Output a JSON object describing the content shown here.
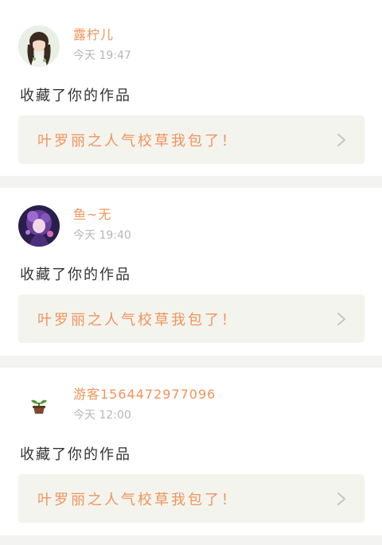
{
  "feed": {
    "items": [
      {
        "username": "露柠儿",
        "time": "今天 19:47",
        "action": "收藏了你的作品",
        "work_title": "叶罗丽之人气校草我包了！",
        "avatar_icon": "girl-avatar-icon"
      },
      {
        "username": "鱼~无",
        "time": "今天 19:40",
        "action": "收藏了你的作品",
        "work_title": "叶罗丽之人气校草我包了！",
        "avatar_icon": "purple-avatar-icon"
      },
      {
        "username": "游客1564472977096",
        "time": "今天 12:00",
        "action": "收藏了你的作品",
        "work_title": "叶罗丽之人气校草我包了！",
        "avatar_icon": "sprout-pot-icon"
      }
    ]
  },
  "colors": {
    "accent": "#f0935a",
    "work_bg": "#f4f4ee",
    "indicator": "#f06a9b"
  }
}
